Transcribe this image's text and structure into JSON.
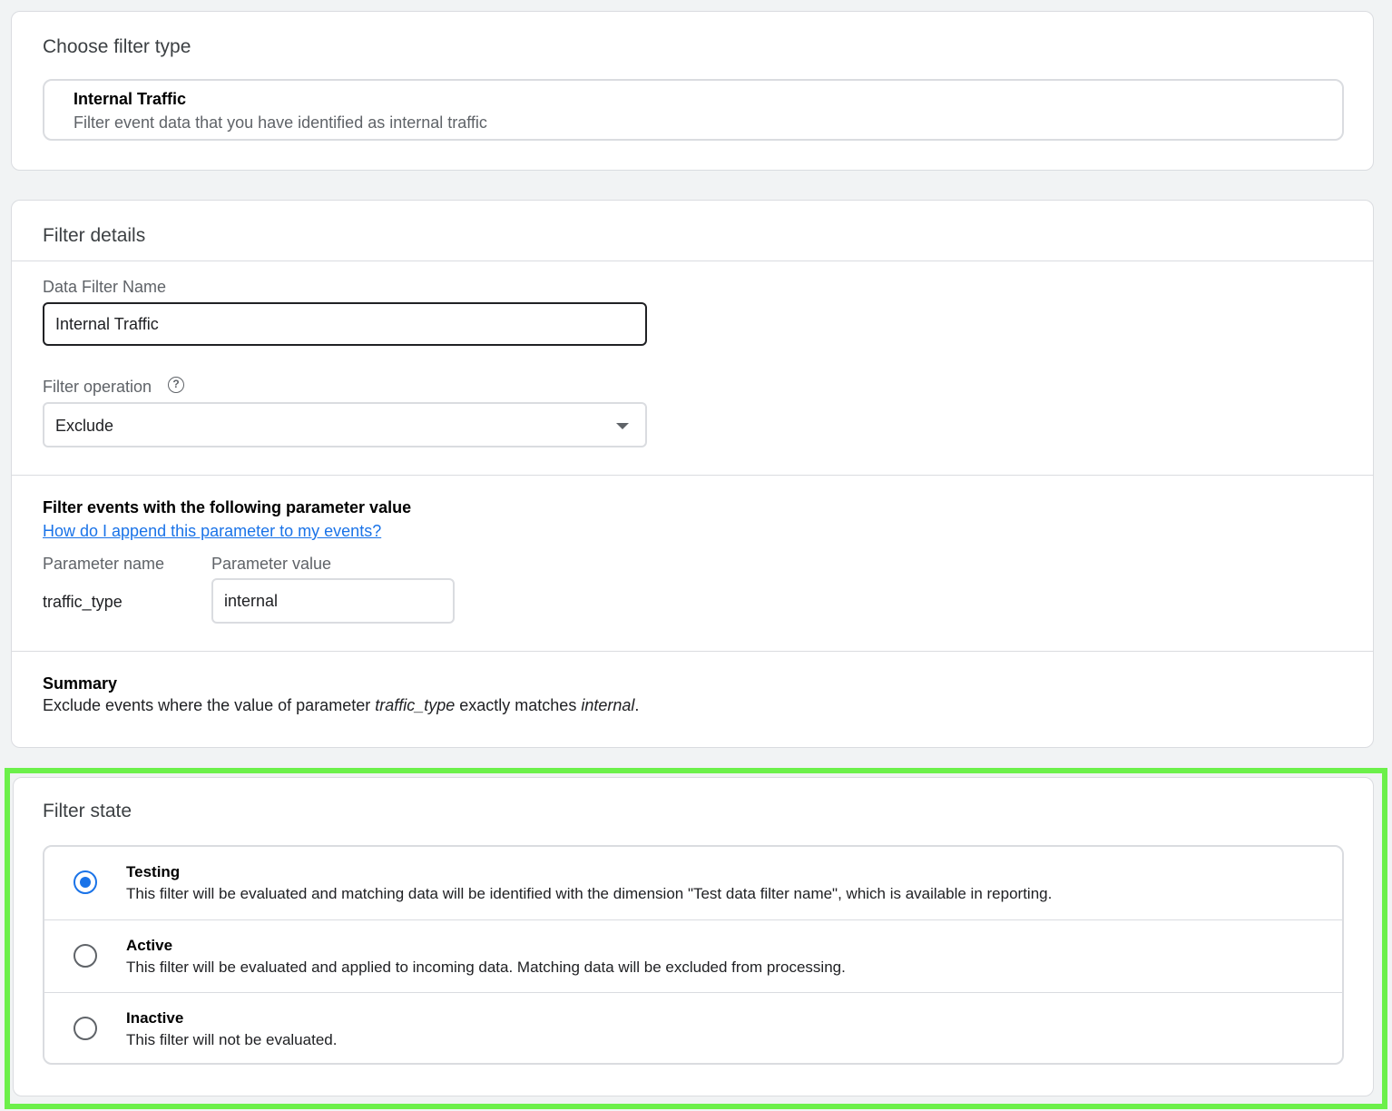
{
  "choose_filter_type": {
    "title": "Choose filter type",
    "option": {
      "title": "Internal Traffic",
      "description": "Filter event data that you have identified as internal traffic"
    }
  },
  "filter_details": {
    "title": "Filter details",
    "name_label": "Data Filter Name",
    "name_value": "Internal Traffic",
    "operation_label": "Filter operation",
    "operation_value": "Exclude",
    "help_icon": "?",
    "params_heading": "Filter events with the following parameter value",
    "params_link": "How do I append this parameter to my events?",
    "param_name_label": "Parameter name",
    "param_name_value": "traffic_type",
    "param_value_label": "Parameter value",
    "param_value_value": "internal",
    "summary_heading": "Summary",
    "summary": {
      "prefix": "Exclude events where the value of parameter ",
      "param": "traffic_type",
      "middle": " exactly matches ",
      "value": "internal",
      "suffix": "."
    }
  },
  "filter_state": {
    "title": "Filter state",
    "options": [
      {
        "title": "Testing",
        "description": "This filter will be evaluated and matching data will be identified with the dimension \"Test data filter name\", which is available in reporting.",
        "selected": true
      },
      {
        "title": "Active",
        "description": "This filter will be evaluated and applied to incoming data. Matching data will be excluded from processing.",
        "selected": false
      },
      {
        "title": "Inactive",
        "description": "This filter will not be evaluated.",
        "selected": false
      }
    ]
  },
  "colors": {
    "accent": "#1a73e8",
    "highlight": "#6cf04a",
    "border": "#dadce0"
  }
}
